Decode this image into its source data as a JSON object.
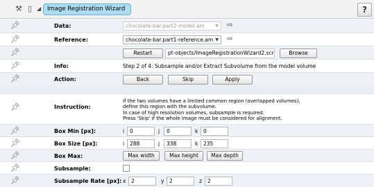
{
  "header": {
    "title": "Image Registration Wizard",
    "icons": [
      "wizard-tool-icon",
      "port-icon",
      "collapse-triangle-icon"
    ],
    "help_label": "?"
  },
  "rows": {
    "data": {
      "label": "Data:",
      "value": "chocolate-bar.part2-model.am"
    },
    "reference": {
      "label": "Reference:",
      "value": "chocolate-bar.part1-reference.am"
    },
    "script": {
      "restart_label": "Restart",
      "path": "pt-objects/ImageRegistrationWizard2.scro",
      "browse_label": "Browse"
    },
    "info": {
      "label": "Info:",
      "text": "Step 2 of 4: Subsample and/or Extract Subvolume from the model volume"
    },
    "action": {
      "label": "Action:",
      "back_label": "Back",
      "skip_label": "Skip",
      "apply_label": "Apply"
    },
    "instruction": {
      "label": "Instruction:",
      "lines": [
        "If the two volumes have a limited common region (overlapped volumes),",
        "define this region with the subvolume.",
        "In case of high resolution volumes, subsample is required.",
        "Press 'Skip' if the whole image must be considered for alignment."
      ]
    },
    "box_min": {
      "label": "Box Min [px]:",
      "axes": [
        "i",
        "j",
        "k"
      ],
      "values": [
        "0",
        "0",
        "0"
      ]
    },
    "box_size": {
      "label": "Box Size [px]:",
      "axes": [
        "i",
        "j",
        "k"
      ],
      "values": [
        "288",
        "338",
        "235"
      ]
    },
    "box_max": {
      "label": "Box Max:",
      "width_label": "Max width",
      "height_label": "Max height",
      "depth_label": "Max depth"
    },
    "subsample": {
      "label": "Subsample:",
      "checked": false
    },
    "subsample_rate": {
      "label": "Subsample Rate [px]:",
      "axes": [
        "x",
        "y",
        "z"
      ],
      "values": [
        "2",
        "2",
        "2"
      ]
    }
  }
}
